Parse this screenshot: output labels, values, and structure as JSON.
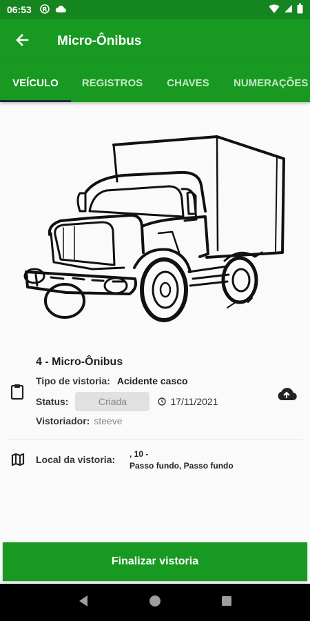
{
  "statusbar": {
    "time": "06:53"
  },
  "appbar": {
    "title": "Micro-Ônibus"
  },
  "tabs": [
    {
      "label": "VEÍCULO",
      "active": true
    },
    {
      "label": "REGISTROS",
      "active": false
    },
    {
      "label": "CHAVES",
      "active": false
    },
    {
      "label": "NUMERAÇÕES",
      "active": false
    }
  ],
  "vehicle": {
    "name": "4 - Micro-Ônibus",
    "inspection_type_label": "Tipo de vistoria:",
    "inspection_type_value": "Acidente casco",
    "status_label": "Status:",
    "status_value": "Criada",
    "date": "17/11/2021",
    "inspector_label": "Vistoriador:",
    "inspector_value": "steeve"
  },
  "location": {
    "label": "Local da vistoria:",
    "line1": ", 10 -",
    "line2": "Passo fundo, Passo fundo"
  },
  "finalize_label": "Finalizar vistoria",
  "colors": {
    "primary": "#189a22",
    "status_bar": "#15851f",
    "tab_indicator": "#1d2b3a"
  }
}
